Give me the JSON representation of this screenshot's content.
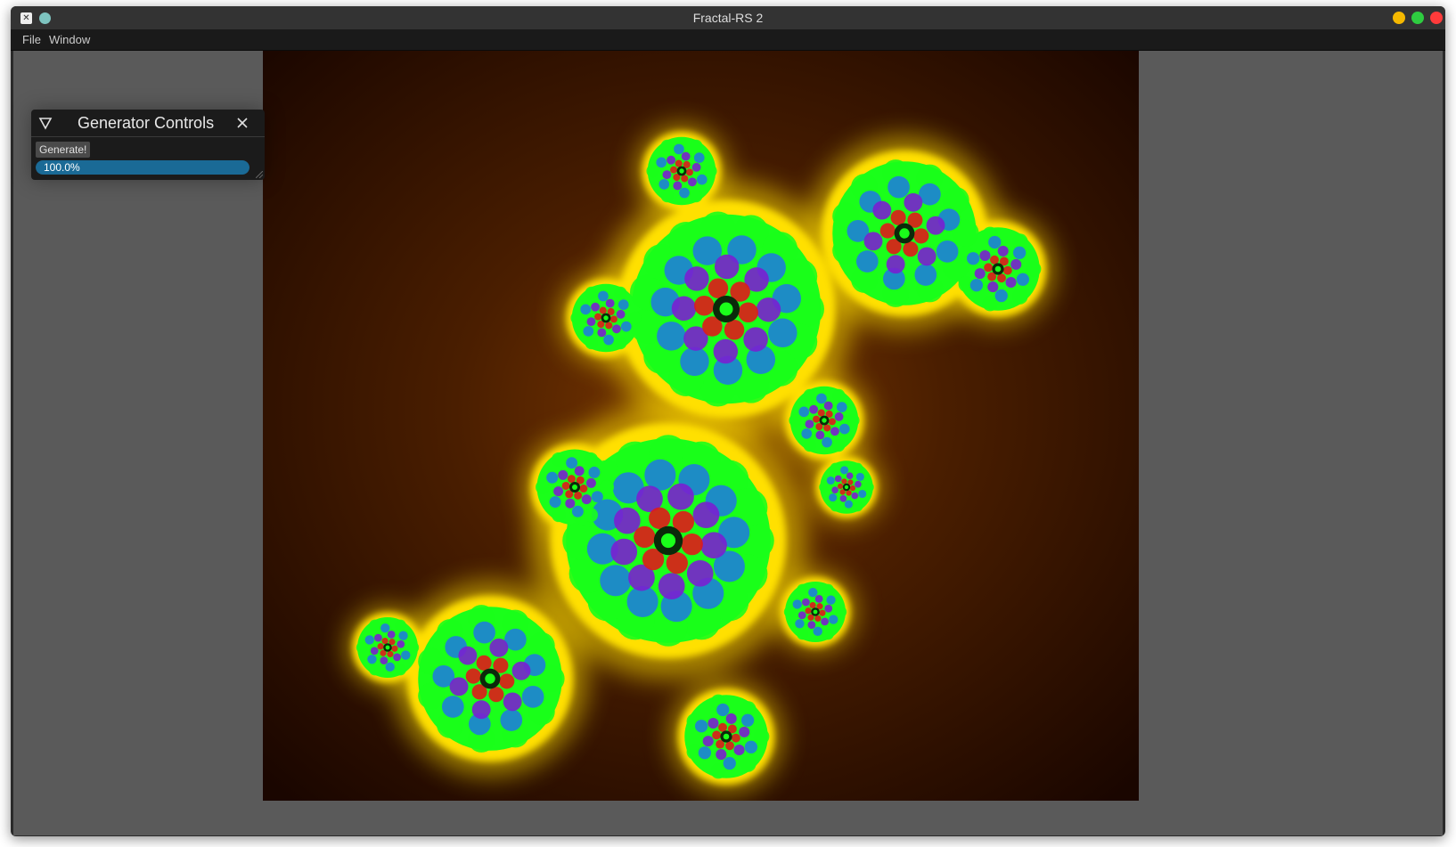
{
  "window": {
    "title": "Fractal-RS 2",
    "pin_color": "#7ec4c0",
    "buttons": {
      "minimize_color": "#f5b800",
      "maximize_color": "#2ecc40",
      "close_color": "#ff3b3b"
    }
  },
  "menubar": {
    "items": [
      "File",
      "Window"
    ]
  },
  "generator_controls": {
    "title": "Generator Controls",
    "generate_label": "Generate!",
    "progress": {
      "value": 1.0,
      "label": "100.0%",
      "color": "#1a6a96"
    }
  },
  "fractal": {
    "type": "julia set",
    "background_colors": [
      "#1a0600",
      "#7a3800"
    ],
    "glow_color": "#ffe000",
    "palette": [
      "#1aff1a",
      "#1e7fd8",
      "#7a1fd0",
      "#e01a1a"
    ]
  },
  "icons": {
    "collapse": "triangle-down-icon",
    "close": "close-icon",
    "app": "app-icon",
    "resize": "resize-grip-icon"
  }
}
